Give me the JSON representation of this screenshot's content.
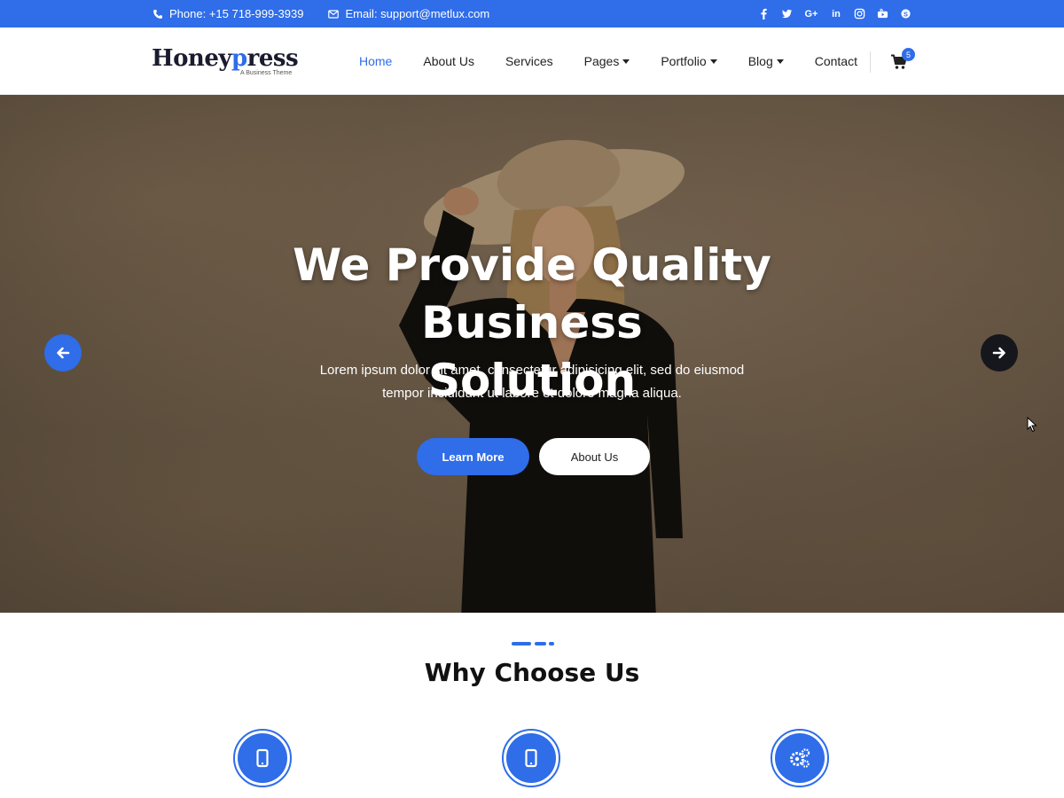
{
  "topbar": {
    "phone": "Phone: +15 718-999-3939",
    "email": "Email: support@metlux.com",
    "social_icons": [
      "facebook-icon",
      "twitter-icon",
      "google-plus-icon",
      "linkedin-icon",
      "instagram-icon",
      "youtube-icon",
      "skype-icon"
    ]
  },
  "header": {
    "logo_main_1": "H",
    "logo_main_2": "oney",
    "logo_accent": "p",
    "logo_main_3": "ress",
    "logo_tagline": "A Business Theme",
    "nav": [
      {
        "label": "Home",
        "active": true,
        "dropdown": false
      },
      {
        "label": "About Us",
        "active": false,
        "dropdown": false
      },
      {
        "label": "Services",
        "active": false,
        "dropdown": false
      },
      {
        "label": "Pages",
        "active": false,
        "dropdown": true
      },
      {
        "label": "Portfolio",
        "active": false,
        "dropdown": true
      },
      {
        "label": "Blog",
        "active": false,
        "dropdown": true
      },
      {
        "label": "Contact",
        "active": false,
        "dropdown": false
      }
    ],
    "cart_count": "5"
  },
  "hero": {
    "title_line1": "We Provide Quality Business",
    "title_line2": "Solution",
    "subtitle_line1": "Lorem ipsum dolor sit amet, consectetur adipisicing elit, sed do eiusmod",
    "subtitle_line2": "tempor incididunt ut labore et dolore magna aliqua.",
    "primary_button": "Learn More",
    "secondary_button": "About Us"
  },
  "why": {
    "title": "Why Choose Us",
    "features": [
      {
        "icon": "mobile-icon"
      },
      {
        "icon": "mobile-icon"
      },
      {
        "icon": "gears-icon"
      }
    ]
  },
  "colors": {
    "accent": "#2f6de9",
    "dark": "#15171c"
  }
}
